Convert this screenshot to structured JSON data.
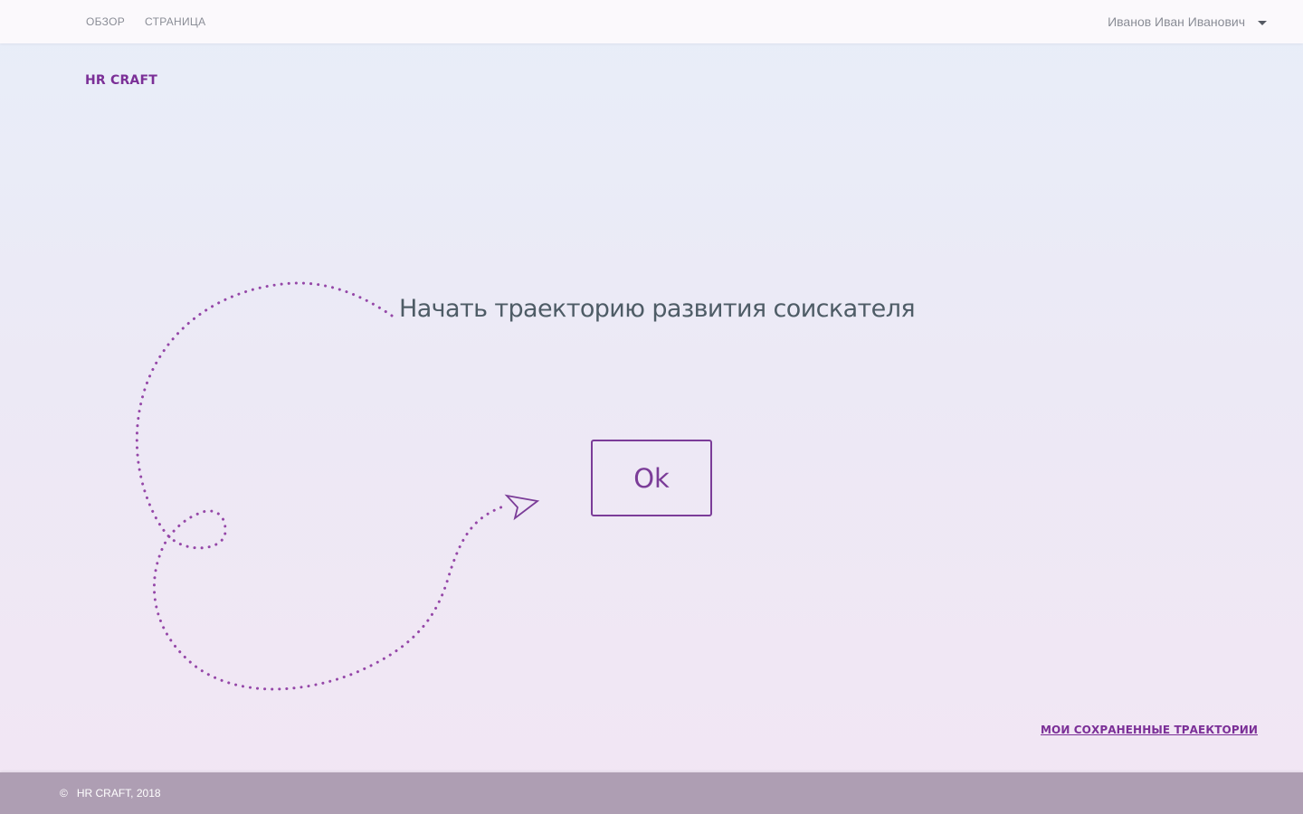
{
  "nav": {
    "items": [
      {
        "label": "ОБЗОР"
      },
      {
        "label": "СТРАНИЦА"
      }
    ],
    "user_name": "Иванов Иван Иванович",
    "user_icon": "chevron-down-icon"
  },
  "brand": {
    "logo": "HR CRAFT",
    "accent_color": "#7b2f97"
  },
  "main": {
    "headline": "Начать траекторию развития соискателя",
    "ok_label": "Ok",
    "decor_icon": "paper-plane-icon",
    "saved_link": "МОИ СОХРАНЕННЫЕ ТРАЕКТОРИИ"
  },
  "footer": {
    "copyright_symbol": "©",
    "copyright_text": "HR CRAFT, 2018"
  }
}
